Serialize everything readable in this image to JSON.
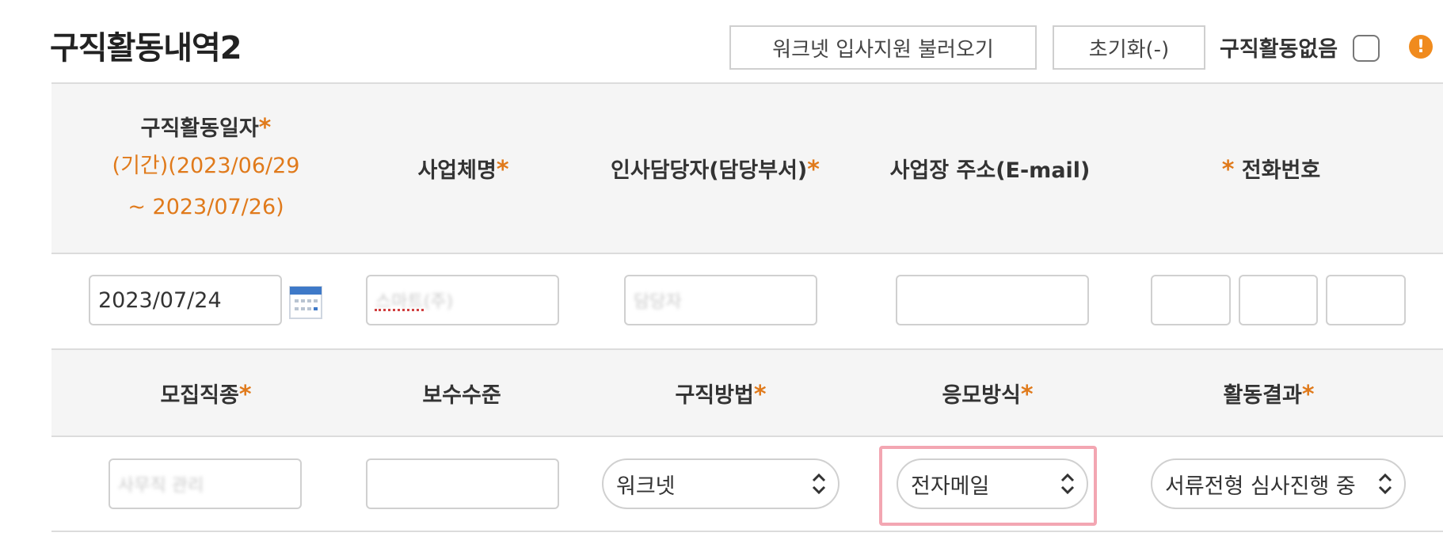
{
  "section": {
    "title": "구직활동내역2",
    "load_button": "워크넷 입사지원 불러오기",
    "reset_button": "초기화(-)",
    "no_activity_label": "구직활동없음",
    "warn_glyph": "!"
  },
  "row1_headers": {
    "date": "구직활동일자",
    "period_line1": "(기간)(2023/06/29",
    "period_line2": "~ 2023/07/26)",
    "company": "사업체명",
    "hr_contact": "인사담당자(담당부서)",
    "address": "사업장 주소(E-mail)",
    "phone": "전화번호",
    "star": "*"
  },
  "row1_values": {
    "date": "2023/07/24",
    "company_blurred": "스마트(주)",
    "hr_blurred": "담당자",
    "address": "",
    "phone": [
      "",
      "",
      ""
    ]
  },
  "row2_headers": {
    "job_type": "모집직종",
    "salary": "보수수준",
    "method": "구직방법",
    "apply_method": "응모방식",
    "result": "활동결과"
  },
  "row2_values": {
    "job_type_blurred": "사무직 관리",
    "salary": "",
    "method": "워크넷",
    "apply_method": "전자메일",
    "result": "서류전형 심사진행 중"
  },
  "colors": {
    "accent": "#e07a1b",
    "highlight": "#f3a6b2",
    "warning": "#f08b1e"
  }
}
